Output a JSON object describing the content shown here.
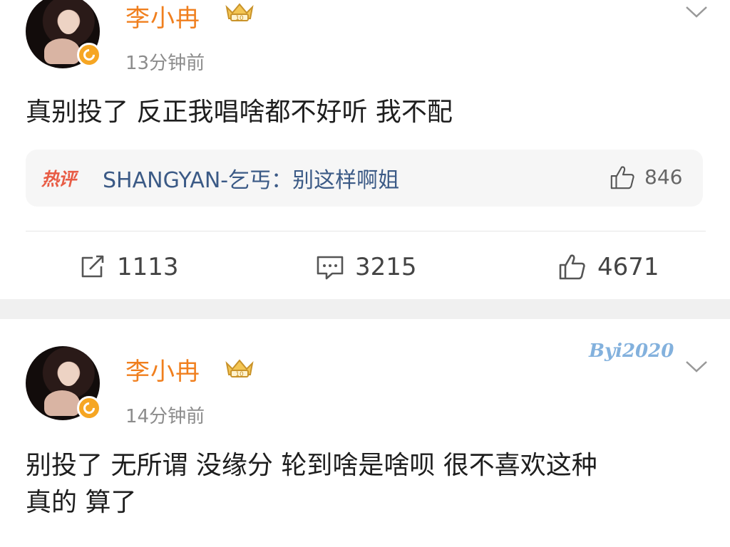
{
  "posts": [
    {
      "username": "李小冉",
      "timestamp": "13分钟前",
      "content_lines": [
        "真别投了 反正我唱啥都不好听 我不配"
      ],
      "hot_comment": {
        "tag": "热评",
        "text": "SHANGYAN-乞丐：别这样啊姐",
        "likes": "846"
      },
      "actions": {
        "repost": "1113",
        "comment": "3215",
        "like": "4671"
      }
    },
    {
      "username": "李小冉",
      "timestamp": "14分钟前",
      "watermark": "Byi2020",
      "content_lines": [
        "别投了 无所谓 没缘分 轮到啥是啥呗 很不喜欢这种",
        "真的 算了"
      ]
    }
  ],
  "icons": {
    "verified": "verified-badge-icon",
    "crown": "crown-badge-icon",
    "menu": "chevron-down-icon",
    "repost": "repost-icon",
    "comment": "comment-icon",
    "like": "thumbs-up-icon"
  },
  "colors": {
    "username": "#f07f1e",
    "hot_comment_user": "#3b5a86",
    "hot_tag": "#e85c45",
    "verified": "#f6a623",
    "separator": "#f0f0f0"
  }
}
